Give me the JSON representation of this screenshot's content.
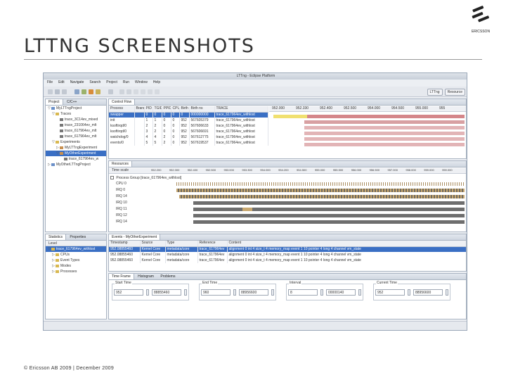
{
  "slide": {
    "title": "LTTNG SCREENSHOTS",
    "footer": "© Ericsson AB 2009 | December 2009",
    "logo_text": "ERICSSON"
  },
  "window": {
    "title": "LTTng - Eclipse Platform",
    "menus": [
      "File",
      "Edit",
      "Navigate",
      "Search",
      "Project",
      "Run",
      "Window",
      "Help"
    ],
    "perspectives": [
      "LTTng",
      "Resource"
    ]
  },
  "project_view": {
    "tabs": [
      "Project",
      "C/C++"
    ],
    "tree": [
      {
        "indent": 0,
        "twisty": "▽",
        "label": "MyLTTngProject",
        "color": "#6a8fc8"
      },
      {
        "indent": 1,
        "twisty": "▽",
        "label": "Traces",
        "color": "#d8b850"
      },
      {
        "indent": 2,
        "twisty": "",
        "label": "trace_3C14ev_mixed",
        "color": "#777777"
      },
      {
        "indent": 2,
        "twisty": "",
        "label": "trace_231064ev_mlt",
        "color": "#777777"
      },
      {
        "indent": 2,
        "twisty": "",
        "label": "trace_617964ev_mlt",
        "color": "#777777"
      },
      {
        "indent": 2,
        "twisty": "",
        "label": "trace_617964ev_mlt",
        "color": "#777777"
      },
      {
        "indent": 1,
        "twisty": "▽",
        "label": "Experiments",
        "color": "#d8b850"
      },
      {
        "indent": 2,
        "twisty": "▷",
        "label": "MyLTTngExperiment",
        "color": "#c89050"
      },
      {
        "indent": 2,
        "twisty": "▽",
        "label": "MyOtherExperiment",
        "color": "#c89050",
        "selected": true
      },
      {
        "indent": 3,
        "twisty": "",
        "label": "trace_617964ev_w",
        "color": "#777777"
      },
      {
        "indent": 0,
        "twisty": "▷",
        "label": "MyOtherLTTngProject",
        "color": "#6a8fc8"
      }
    ]
  },
  "control_flow": {
    "tab": "Control Flow",
    "columns": [
      "Process",
      "Brand",
      "PID",
      "TGID",
      "PPID",
      "CPU",
      "Birth s",
      "Birth ns",
      "TRACE"
    ],
    "time_ticks": [
      "952.000",
      "952.330",
      "952.400",
      "952.500",
      "954.000",
      "954.500",
      "955.000",
      "955"
    ],
    "rows": [
      [
        "swapper",
        "",
        "0",
        "0",
        "0",
        "0",
        "0",
        "000000000",
        "trace_617964ev_withlost"
      ],
      [
        "init",
        "",
        "1",
        "1",
        "0",
        "0",
        "952",
        "567605379",
        "trace_617964ev_withlost"
      ],
      [
        "ksoftirqd/0",
        "",
        "2",
        "2",
        "0",
        "0",
        "952",
        "567606633",
        "trace_617964ev_withlost"
      ],
      [
        "ksoftirqd/0",
        "",
        "3",
        "2",
        "0",
        "0",
        "952",
        "567606691",
        "trace_617964ev_withlost"
      ],
      [
        "watchdog/0",
        "",
        "4",
        "4",
        "2",
        "0",
        "952",
        "567612775",
        "trace_617964ev_withlost"
      ],
      [
        "events/0",
        "",
        "5",
        "5",
        "2",
        "0",
        "952",
        "567619537",
        "trace_617964ev_withlost"
      ]
    ]
  },
  "resources": {
    "tab": "Resources",
    "time_scale_label": "Time scale",
    "time_ticks": [
      "952.200",
      "952.300",
      "952.400",
      "952.500",
      "953.000",
      "953.300",
      "954.000",
      "954.200",
      "954.500",
      "955.000",
      "955.500",
      "956.000",
      "956.500",
      "957.000",
      "958.000",
      "959.000",
      "959.000"
    ],
    "group_label": "Process Group [trace_617964ev_withlost]",
    "rows": [
      "CPU 0",
      "IRQ 0",
      "IRQ 14",
      "IRQ 10",
      "IRQ 11",
      "IRQ 12",
      "IRQ 14"
    ]
  },
  "statistics": {
    "tabs": [
      "Statistics",
      "Properties"
    ],
    "header": "Level",
    "tree": [
      {
        "indent": 0,
        "twisty": "▽",
        "label": "trace_617964ev_withlost",
        "selected": true
      },
      {
        "indent": 1,
        "twisty": "▷",
        "label": "CPUs"
      },
      {
        "indent": 1,
        "twisty": "▷",
        "label": "Event Types"
      },
      {
        "indent": 1,
        "twisty": "▷",
        "label": "Modes"
      },
      {
        "indent": 1,
        "twisty": "▷",
        "label": "Processes"
      }
    ]
  },
  "events": {
    "tab": "Events - MyOtherExperiment",
    "columns": [
      "Timestamp",
      "Source",
      "Type",
      "Reference",
      "Content"
    ],
    "rows": [
      [
        "952.08855460",
        "Kernel Core",
        "metadata/core",
        "trace_617964ev",
        "alignment 0 int 4 size_t 4 memory_map event 1 10 pointer 4 long 4 channel vm_state"
      ],
      [
        "952.08855460",
        "Kernel Core",
        "metadata/core",
        "trace_617964ev",
        "alignment 0 int 4 size_t 4 memory_map event 1 10 pointer 4 long 4 channel vm_state"
      ],
      [
        "952.08855460",
        "Kernel Core",
        "metadata/core",
        "trace_617964ev",
        "alignment 0 int 4 size_t 4 memory_map event 1 10 pointer 4 long 4 channel vm_state"
      ]
    ]
  },
  "time_frame": {
    "tabs": [
      "Time Frame",
      "Histogram",
      "Problems"
    ],
    "groups": [
      {
        "label": "Start Time",
        "s": "952",
        "ns": "88855460"
      },
      {
        "label": "End Time",
        "s": "960",
        "ns": "88956600"
      },
      {
        "label": "Interval",
        "s": "8",
        "ns": "00000140"
      },
      {
        "label": "Current Time",
        "s": "952",
        "ns": "88956600"
      }
    ]
  }
}
